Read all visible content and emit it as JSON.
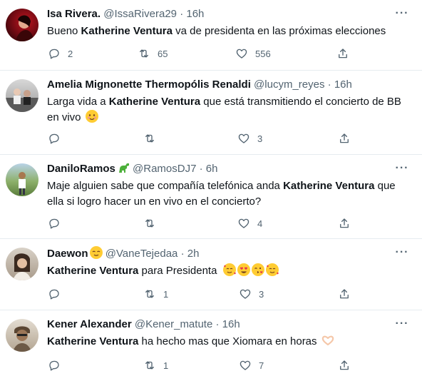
{
  "tweets": [
    {
      "name": "Isa Rivera.",
      "handle": "@IssaRivera29",
      "sep": "·",
      "time": "16h",
      "text_pre": "Bueno ",
      "text_bold": "Katherine Ventura",
      "text_post": " va de presidenta en las próximas elecciones",
      "replies": "2",
      "retweets": "65",
      "likes": "556"
    },
    {
      "name": "Amelia Mignonette Thermopólis Renaldi",
      "handle": "@lucym_reyes",
      "sep": "·",
      "time": "16h",
      "text_pre": "Larga vida a ",
      "text_bold": "Katherine Ventura",
      "text_post": " que está transmitiendo el concierto de BB",
      "text_line2": "en vivo",
      "replies": "",
      "retweets": "",
      "likes": "3"
    },
    {
      "name": "DaniloRamos",
      "handle": "@RamosDJ7",
      "sep": "·",
      "time": "6h",
      "text_pre": "Maje  alguien sabe que compañía telefónica anda ",
      "text_bold": "Katherine Ventura",
      "text_post": " que",
      "text_line2": "ella si logro hacer un en vivo en el concierto?",
      "replies": "",
      "retweets": "",
      "likes": "4"
    },
    {
      "name": "Daewon",
      "handle": "@VaneTejedaa",
      "sep": "·",
      "time": "2h",
      "text_pre": "",
      "text_bold": "Katherine Ventura",
      "text_post": " para Presidenta",
      "replies": "",
      "retweets": "1",
      "likes": "3"
    },
    {
      "name": "Kener Alexander",
      "handle": "@Kener_matute",
      "sep": "·",
      "time": "16h",
      "text_pre": "",
      "text_bold": "Katherine Ventura",
      "text_post": " ha hecho mas que Xiomara en horas",
      "replies": "",
      "retweets": "1",
      "likes": "7"
    }
  ],
  "icons": {
    "reply": "reply-icon",
    "retweet": "retweet-icon",
    "like": "heart-icon",
    "share": "share-icon",
    "more": "more-options-icon"
  },
  "colors": {
    "text": "#0f1419",
    "meta": "#536471",
    "divider": "#e6ecf0"
  }
}
